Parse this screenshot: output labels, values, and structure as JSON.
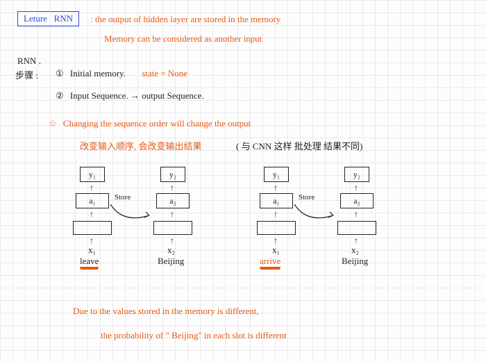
{
  "title": {
    "lecture": "Leture",
    "topic": "RNN"
  },
  "intro": {
    "line1": ":  the output of hidden layer are stored in the memory",
    "line2": "Memory can be considered as another input"
  },
  "section": {
    "rnn": "RNN .",
    "steps": "步骤 :"
  },
  "steps": {
    "one_num": "①",
    "one_text": "Initial memory.",
    "one_state": "state = None",
    "two_num": "②",
    "two_text": "Input Sequence. → output Sequence."
  },
  "note": {
    "star": "☆",
    "en": "Changing the sequence order will change the output",
    "zh": "改变输入顺序, 会改变输出结果",
    "zh_paren": "( 与 CNN 这样 批处理 结果不同)"
  },
  "diagram": {
    "y1": "y₁",
    "y2": "y₂",
    "a1": "a₁",
    "a2": "a₂",
    "x1": "x₁",
    "x2": "x₂",
    "store": "Store",
    "leave": "leave",
    "beijing": "Beijing",
    "arrive": "arrive"
  },
  "conclusion": {
    "line1": "Due to the values stored in the memory is different,",
    "line2": "the probability of \" Beijing\" in each  slot  is different"
  }
}
